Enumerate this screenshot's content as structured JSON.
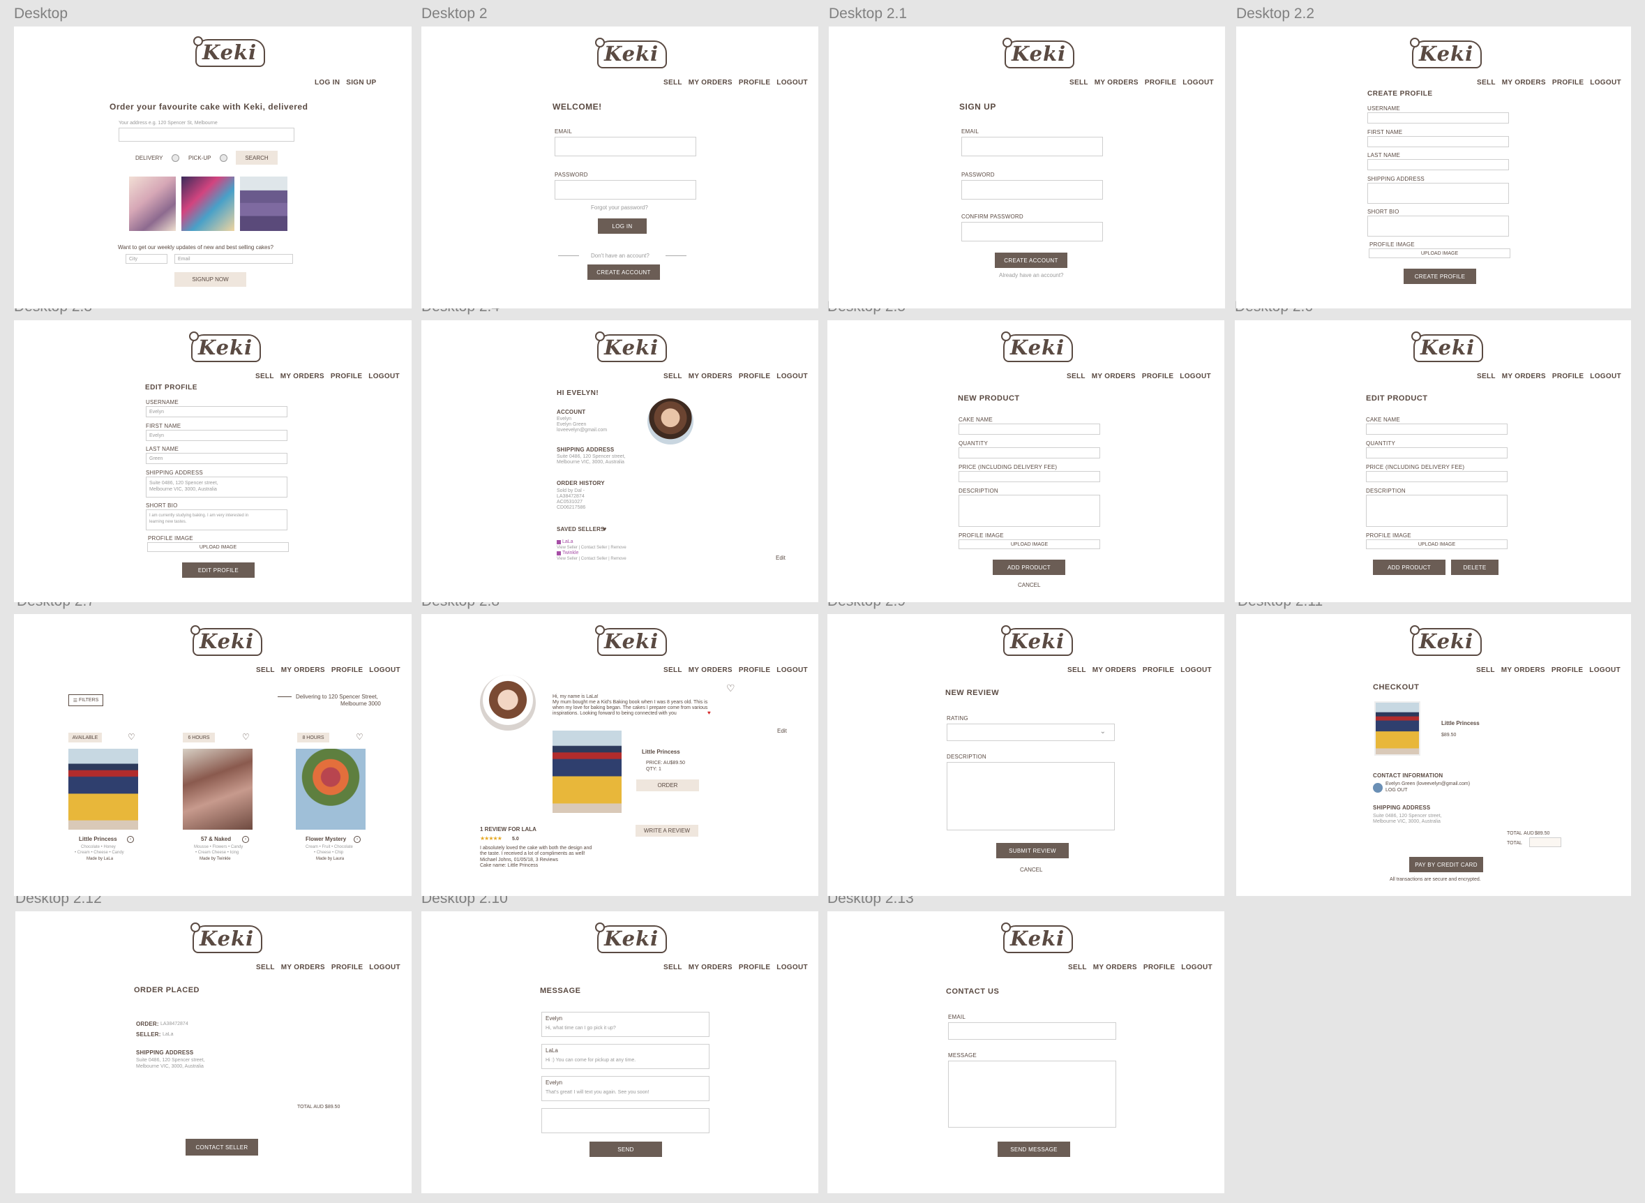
{
  "labels": {
    "a1": "Desktop",
    "a2": "Desktop 2",
    "a3": "Desktop 2.1",
    "a4": "Desktop 2.2",
    "b1": "Desktop 2.3",
    "b2": "Desktop 2.4",
    "b3": "Desktop 2.5",
    "b4": "Desktop 2.6",
    "c1": "Desktop 2.7",
    "c2": "Desktop 2.8",
    "c3": "Desktop 2.9",
    "c4": "Desktop 2.11",
    "d1": "Desktop 2.12",
    "d2": "Desktop 2.10",
    "d3": "Desktop 2.13"
  },
  "logo": "Keki",
  "nav": {
    "login": "LOG IN",
    "signup": "SIGN UP",
    "sell": "SELL",
    "orders": "MY ORDERS",
    "profile": "PROFILE",
    "logout": "LOGOUT"
  },
  "home": {
    "heading": "Order your favourite cake with Keki, delivered",
    "address_ph": "Your address e.g. 120 Spencer St, Melbourne",
    "delivery": "DELIVERY",
    "pickup": "PICK-UP",
    "search": "SEARCH",
    "newsletter": "Want to get our weekly updates of new and best selling cakes?",
    "city": "City",
    "email": "Email",
    "signup_now": "SIGNUP NOW"
  },
  "login": {
    "title": "WELCOME!",
    "email": "EMAIL",
    "password": "PASSWORD",
    "forgot": "Forgot your password?",
    "btn": "LOG IN",
    "noacct": "Don't have an account?",
    "create": "CREATE ACCOUNT"
  },
  "signup": {
    "title": "SIGN UP",
    "email": "EMAIL",
    "password": "PASSWORD",
    "confirm": "CONFIRM PASSWORD",
    "btn": "CREATE ACCOUNT",
    "have": "Already have an account?"
  },
  "create_profile": {
    "title": "CREATE PROFILE",
    "username": "USERNAME",
    "first": "FIRST NAME",
    "last": "LAST NAME",
    "shipping": "SHIPPING ADDRESS",
    "bio": "SHORT BIO",
    "image": "PROFILE IMAGE",
    "upload": "UPLOAD IMAGE",
    "btn": "CREATE PROFILE"
  },
  "edit_profile": {
    "title": "EDIT PROFILE",
    "username": "USERNAME",
    "username_v": "Evelyn",
    "first": "FIRST NAME",
    "first_v": "Evelyn",
    "last": "LAST NAME",
    "last_v": "Green",
    "shipping": "SHIPPING ADDRESS",
    "ship_v1": "Suite 0486, 120 Spencer street,",
    "ship_v2": "Melbourne VIC, 3000, Australia",
    "bio": "SHORT BIO",
    "bio_v1": "I am currently studying baking. I am very interested in",
    "bio_v2": "learning new tastes.",
    "image": "PROFILE IMAGE",
    "upload": "UPLOAD IMAGE",
    "btn": "EDIT PROFILE"
  },
  "profile": {
    "hi": "HI EVELYN!",
    "account": "ACCOUNT",
    "acc1": "Evelyn",
    "acc2": "Evelyn Green",
    "acc3": "loveevelyn@gmail.com",
    "shipping": "SHIPPING ADDRESS",
    "ship1": "Suite 0486, 120 Spencer street,",
    "ship2": "Melbourne VIC, 3000, Australia",
    "history": "ORDER HISTORY",
    "h1": "Sold by Dal -",
    "h2": "LA38472874",
    "h3": "AC0531027",
    "h4": "CD06217586",
    "saved": "SAVED SELLERS",
    "s1": "LaLa",
    "s1l": "View Seller | Contact Seller | Remove",
    "s2": "Twinkle",
    "s2l": "View Seller | Contact Seller | Remove",
    "edit": "Edit"
  },
  "new_product": {
    "title": "NEW PRODUCT",
    "name": "CAKE NAME",
    "qty": "QUANTITY",
    "price": "PRICE (INCLUDING DELIVERY FEE)",
    "desc": "DESCRIPTION",
    "image": "PROFILE IMAGE",
    "upload": "UPLOAD IMAGE",
    "btn": "ADD PRODUCT",
    "cancel": "CANCEL"
  },
  "edit_product": {
    "title": "EDIT PRODUCT",
    "name": "CAKE NAME",
    "qty": "QUANTITY",
    "price": "PRICE (INCLUDING DELIVERY FEE)",
    "desc": "DESCRIPTION",
    "image": "PROFILE IMAGE",
    "upload": "UPLOAD IMAGE",
    "btn": "ADD PRODUCT",
    "delete": "DELETE"
  },
  "listing": {
    "filters": "FILTERS",
    "deliv1": "Delivering to 120 Spencer Street,",
    "deliv2": "Melbourne 3000",
    "items": [
      {
        "tag": "AVAILABLE",
        "name": "Little Princess",
        "d1": "Chocolate • Honey",
        "d2": "• Cream • Cheese • Candy",
        "by": "Made by LaLa"
      },
      {
        "tag": "6 HOURS",
        "name": "57 & Naked",
        "d1": "Mousse • Flowers • Candy",
        "d2": "• Cream Cheese • Icing",
        "by": "Made by Twinkle"
      },
      {
        "tag": "8 HOURS",
        "name": "Flower Mystery",
        "d1": "Cream • Fruit • Chocolate",
        "d2": "• Cheese • Chip",
        "by": "Made by Laura"
      }
    ]
  },
  "seller": {
    "bio1": "Hi, my name is LaLa!",
    "bio2": "My mum bought me a Kid's Baking book when I was 8 years old. This is",
    "bio3": "when my love for baking began. The cakes I prepare come from various",
    "bio4": "inspirations. Looking forward to being connected with you",
    "edit": "Edit",
    "product": "Little Princess",
    "price": "PRICE: AU$89.50",
    "qty": "QTY:",
    "qty_v": "1",
    "order": "ORDER",
    "reviews": "1 REVIEW FOR LALA",
    "rating": "5.0",
    "write": "WRITE A REVIEW",
    "r1": "I absolutely loved the cake with both the design and",
    "r2": "the taste. I received a lot of compliments as well!",
    "r3": "Michael Johns, 01/05/18, 3 Reviews",
    "r4": "Cake name: Little Princess"
  },
  "review": {
    "title": "NEW REVIEW",
    "rating": "RATING",
    "desc": "DESCRIPTION",
    "btn": "SUBMIT REVIEW",
    "cancel": "CANCEL"
  },
  "checkout": {
    "title": "CHECKOUT",
    "product": "Little Princess",
    "price": "$89.50",
    "contact": "CONTACT INFORMATION",
    "contact_v": "Evelyn Green (loveevelyn@gmail.com)",
    "logout": "LOG OUT",
    "shipping": "SHIPPING ADDRESS",
    "ship1": "Suite 0486, 120 Spencer street,",
    "ship2": "Melbourne VIC, 3000, Australia",
    "total": "TOTAL",
    "aud": "AUD",
    "total_v": "$89.50",
    "total2": "TOTAL",
    "pay": "PAY BY CREDIT CARD",
    "secure": "All transactions are secure and encrypted."
  },
  "placed": {
    "title": "ORDER PLACED",
    "order": "ORDER:",
    "order_v": "LA38472874",
    "seller": "SELLER:",
    "seller_v": "LaLa",
    "shipping": "SHIPPING ADDRESS",
    "ship1": "Suite 0486, 120 Spencer street,",
    "ship2": "Melbourne VIC, 3000, Australia",
    "total": "TOTAL AUD $89.50",
    "btn": "CONTACT SELLER"
  },
  "message": {
    "title": "MESSAGE",
    "m": [
      {
        "who": "Evelyn",
        "text": "Hi, what time can I go pick it up?"
      },
      {
        "who": "LaLa",
        "text": "Hi :) You can come for pickup at any time."
      },
      {
        "who": "Evelyn",
        "text": "That's great! I will text you again. See you soon!"
      }
    ],
    "btn": "SEND"
  },
  "contact": {
    "title": "CONTACT US",
    "email": "EMAIL",
    "message": "MESSAGE",
    "btn": "SEND MESSAGE"
  }
}
